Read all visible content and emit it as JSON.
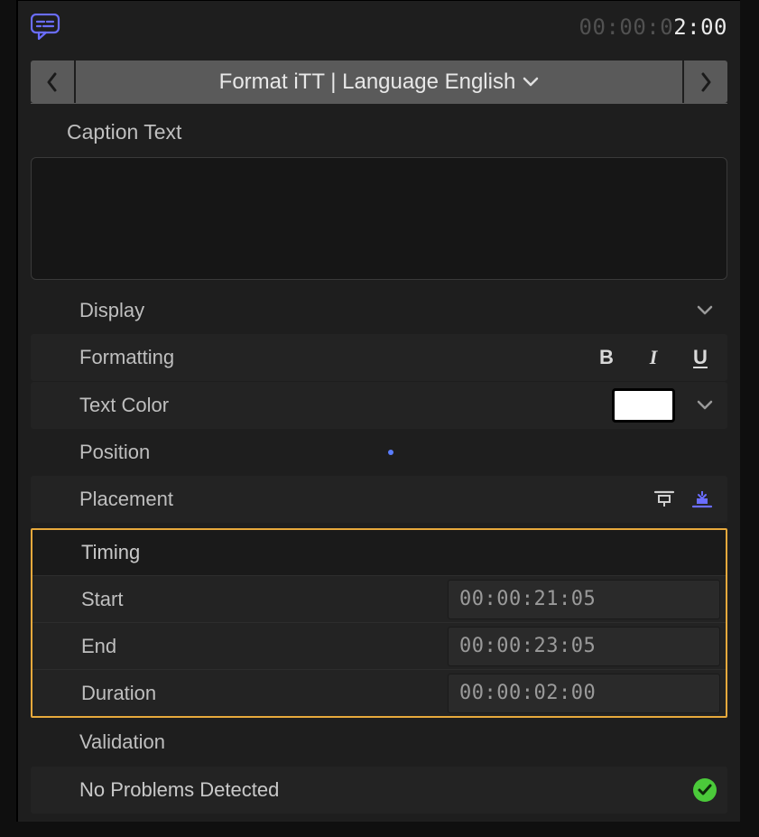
{
  "header": {
    "timecode_dim": "00:00:0",
    "timecode_bright": "2:00"
  },
  "nav": {
    "label": "Format iTT | Language English"
  },
  "caption": {
    "label": "Caption Text",
    "value": ""
  },
  "display": {
    "label": "Display"
  },
  "formatting": {
    "label": "Formatting",
    "bold": "B",
    "italic": "I",
    "underline": "U"
  },
  "textcolor": {
    "label": "Text Color",
    "value": "#ffffff"
  },
  "position": {
    "label": "Position"
  },
  "placement": {
    "label": "Placement"
  },
  "timing": {
    "label": "Timing",
    "start_label": "Start",
    "start_value": "00:00:21:05",
    "end_label": "End",
    "end_value": "00:00:23:05",
    "duration_label": "Duration",
    "duration_value": "00:00:02:00"
  },
  "validation": {
    "label": "Validation",
    "status": "No Problems Detected"
  }
}
